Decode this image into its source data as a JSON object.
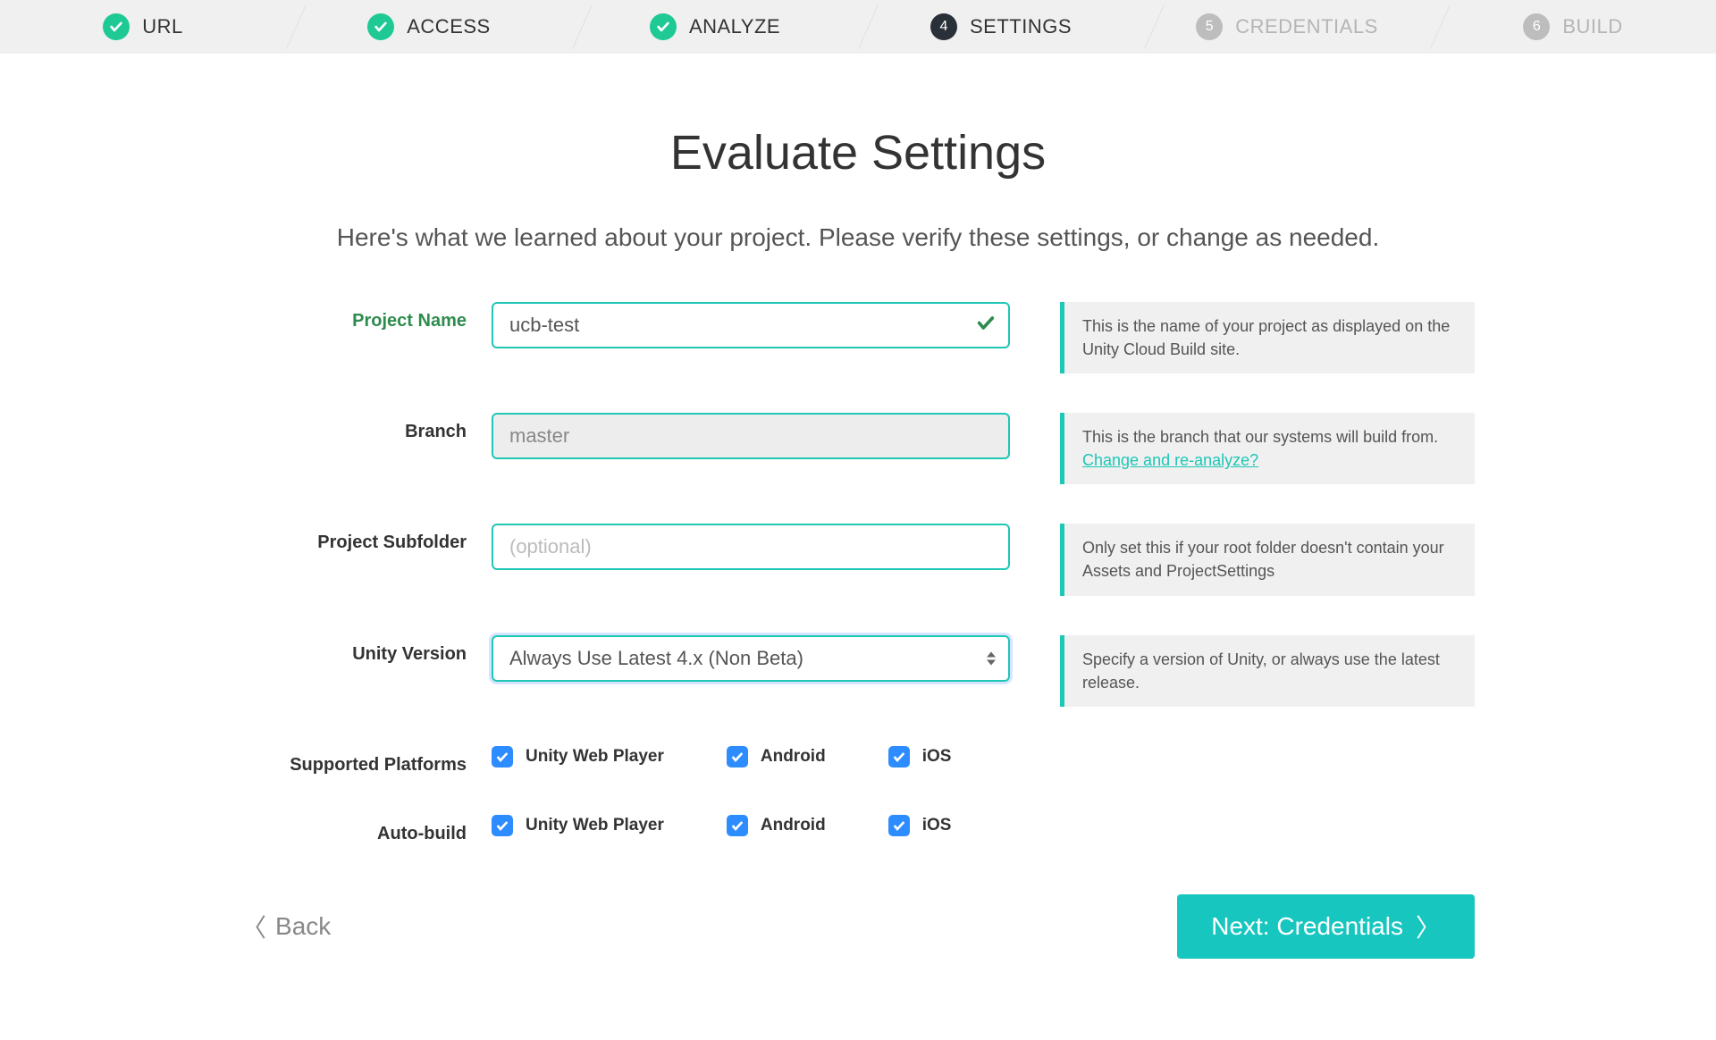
{
  "stepper": [
    {
      "num": "✓",
      "label": "URL",
      "state": "done"
    },
    {
      "num": "✓",
      "label": "ACCESS",
      "state": "done"
    },
    {
      "num": "✓",
      "label": "ANALYZE",
      "state": "done"
    },
    {
      "num": "4",
      "label": "SETTINGS",
      "state": "current"
    },
    {
      "num": "5",
      "label": "CREDENTIALS",
      "state": "pending"
    },
    {
      "num": "6",
      "label": "BUILD",
      "state": "pending"
    }
  ],
  "page": {
    "title": "Evaluate Settings",
    "subtitle": "Here's what we learned about your project. Please verify these settings, or change as needed."
  },
  "form": {
    "project_name": {
      "label": "Project Name",
      "value": "ucb-test",
      "hint": "This is the name of your project as displayed on the Unity Cloud Build site."
    },
    "branch": {
      "label": "Branch",
      "value": "master",
      "hint": "This is the branch that our systems will build from.",
      "hint_link": "Change and re-analyze?"
    },
    "subfolder": {
      "label": "Project Subfolder",
      "value": "",
      "placeholder": "(optional)",
      "hint": "Only set this if your root folder doesn't contain your Assets and ProjectSettings"
    },
    "unity_version": {
      "label": "Unity Version",
      "value": "Always Use Latest 4.x (Non Beta)",
      "hint": "Specify a version of Unity, or always use the latest release."
    },
    "supported": {
      "label": "Supported Platforms",
      "items": [
        {
          "label": "Unity Web Player",
          "checked": true
        },
        {
          "label": "Android",
          "checked": true
        },
        {
          "label": "iOS",
          "checked": true
        }
      ]
    },
    "autobuild": {
      "label": "Auto-build",
      "items": [
        {
          "label": "Unity Web Player",
          "checked": true
        },
        {
          "label": "Android",
          "checked": true
        },
        {
          "label": "iOS",
          "checked": true
        }
      ]
    }
  },
  "footer": {
    "back": "Back",
    "next": "Next: Credentials"
  }
}
